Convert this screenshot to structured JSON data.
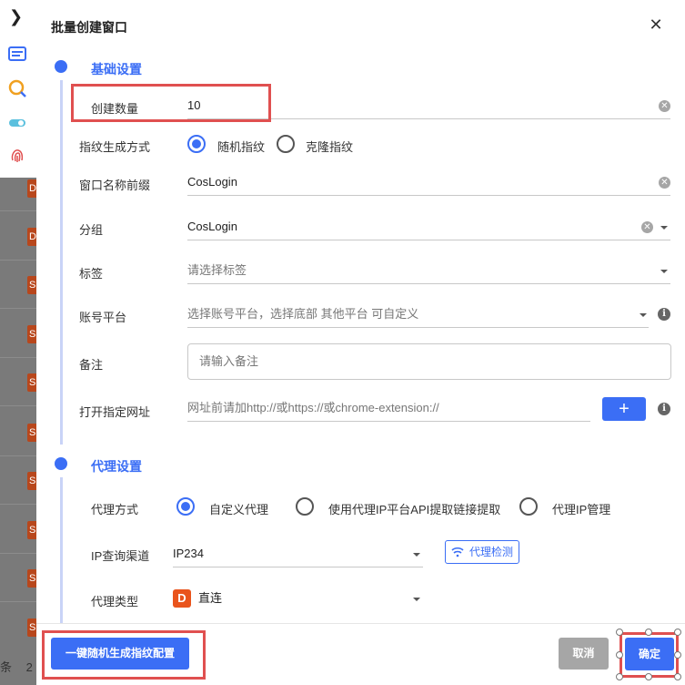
{
  "background": {
    "rows_badges": [
      "D",
      "D",
      "S",
      "S",
      "S",
      "S",
      "S",
      "S",
      "S",
      "S",
      "S"
    ],
    "footer_text": "条",
    "footer_prefix": "2"
  },
  "dialog": {
    "title": "批量创建窗口",
    "close_icon": "close-icon"
  },
  "basic": {
    "section_title": "基础设置",
    "count": {
      "label": "创建数量",
      "value": "10"
    },
    "fingerprint_mode": {
      "label": "指纹生成方式",
      "options": [
        "随机指纹",
        "克隆指纹"
      ],
      "selected": "随机指纹"
    },
    "name_prefix": {
      "label": "窗口名称前缀",
      "value": "CosLogin"
    },
    "group": {
      "label": "分组",
      "value": "CosLogin"
    },
    "tags": {
      "label": "标签",
      "placeholder": "请选择标签"
    },
    "account_platform": {
      "label": "账号平台",
      "placeholder": "选择账号平台，选择底部 其他平台 可自定义"
    },
    "remark": {
      "label": "备注",
      "placeholder": "请输入备注"
    },
    "open_url": {
      "label": "打开指定网址",
      "placeholder": "网址前请加http://或https://或chrome-extension://",
      "add_label": "+"
    }
  },
  "proxy": {
    "section_title": "代理设置",
    "mode": {
      "label": "代理方式",
      "options": [
        "自定义代理",
        "使用代理IP平台API提取链接提取",
        "代理IP管理"
      ],
      "selected": "自定义代理"
    },
    "ip_channel": {
      "label": "IP查询渠道",
      "value": "IP234",
      "check_label": "代理检测"
    },
    "proxy_type": {
      "label": "代理类型",
      "badge": "D",
      "value": "直连"
    }
  },
  "footer": {
    "random_config_label": "一键随机生成指纹配置",
    "cancel_label": "取消",
    "confirm_label": "确定"
  },
  "colors": {
    "accent": "#3b6ef5",
    "highlight": "#e05050",
    "badge_orange": "#e9541c"
  }
}
